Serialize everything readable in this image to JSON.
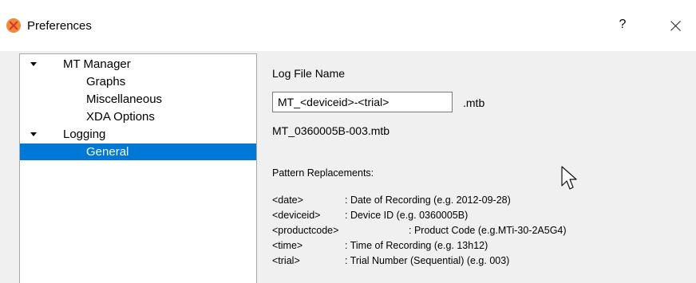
{
  "window": {
    "title": "Preferences",
    "help_label": "?",
    "icons": {
      "app": "xsens-logo-icon",
      "close": "close-icon"
    }
  },
  "tree": {
    "items": [
      {
        "label": "MT Manager",
        "expanded": true
      },
      {
        "label": "Graphs"
      },
      {
        "label": "Miscellaneous"
      },
      {
        "label": "XDA Options"
      },
      {
        "label": "Logging",
        "expanded": true
      },
      {
        "label": "General",
        "selected": true
      }
    ]
  },
  "log": {
    "label": "Log File Name",
    "value": "MT_<deviceid>-<trial>",
    "extension": ".mtb",
    "example": "MT_0360005B-003.mtb"
  },
  "patterns": {
    "title": "Pattern Replacements:",
    "rows": [
      {
        "key": "<date>",
        "desc": ": Date of Recording (e.g. 2012-09-28)"
      },
      {
        "key": "<deviceid>",
        "desc": ": Device ID (e.g. 0360005B)"
      },
      {
        "key": "<productcode>",
        "desc": ": Product Code (e.g.MTi-30-2A5G4)"
      },
      {
        "key": "<time>",
        "desc": ": Time of Recording (e.g. 13h12)"
      },
      {
        "key": "<trial>",
        "desc": ": Trial Number (Sequential) (e.g. 003)"
      }
    ]
  },
  "colors": {
    "selection": "#0078d7",
    "panel": "#f0f0f0",
    "app_icon": "#f28a3a"
  }
}
